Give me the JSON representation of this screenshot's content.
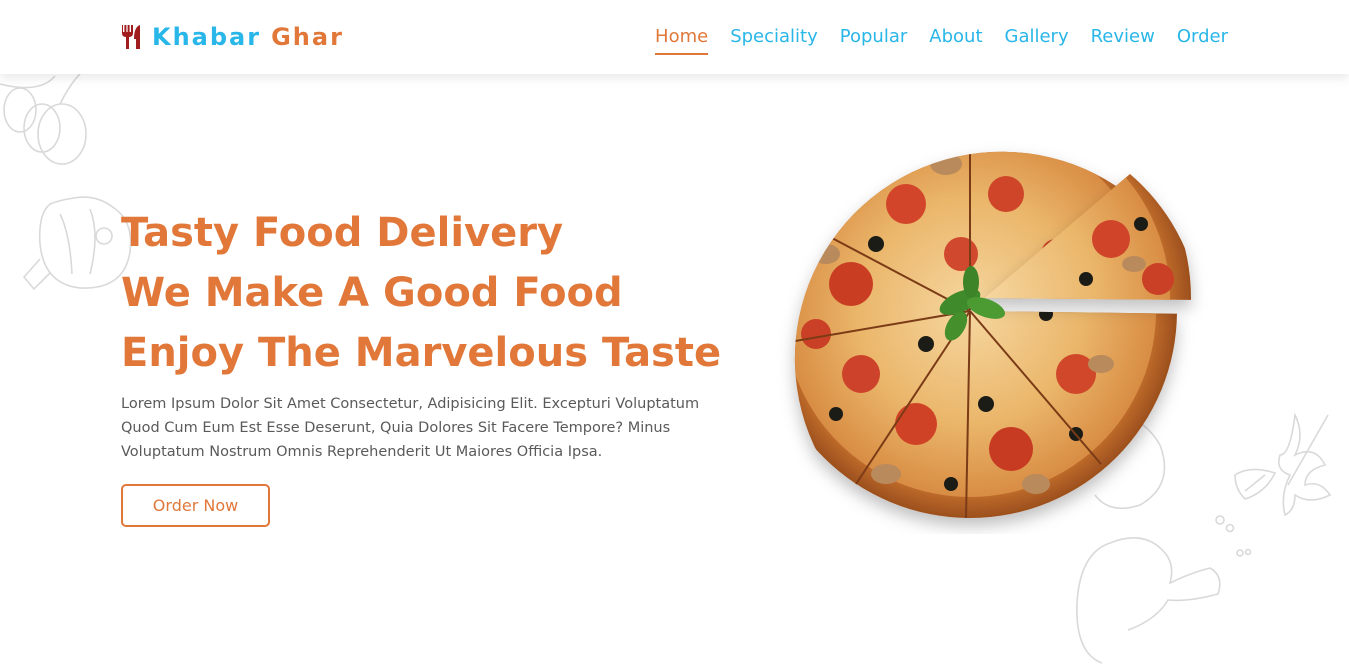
{
  "brand": {
    "word1": "Khabar",
    "word2": "Ghar",
    "icon": "utensils-icon",
    "colors": {
      "blue": "#29b6e8",
      "orange": "#e1783a",
      "icon_red": "#a11d1d"
    }
  },
  "nav": {
    "items": [
      {
        "label": "Home",
        "active": true
      },
      {
        "label": "Speciality"
      },
      {
        "label": "Popular"
      },
      {
        "label": "About"
      },
      {
        "label": "Gallery"
      },
      {
        "label": "Review"
      },
      {
        "label": "Order"
      }
    ]
  },
  "hero": {
    "lines": [
      "Tasty Food Delivery",
      "We Make A Good Food",
      "Enjoy The Marvelous Taste"
    ],
    "description": "Lorem Ipsum Dolor Sit Amet Consectetur, Adipisicing Elit. Excepturi Voluptatum Quod Cum Eum Est Esse Deserunt, Quia Dolores Sit Facere Tempore? Minus Voluptatum Nostrum Omnis Reprehenderit Ut Maiores Officia Ipsa.",
    "button_label": "Order Now",
    "image": "pizza-image"
  }
}
